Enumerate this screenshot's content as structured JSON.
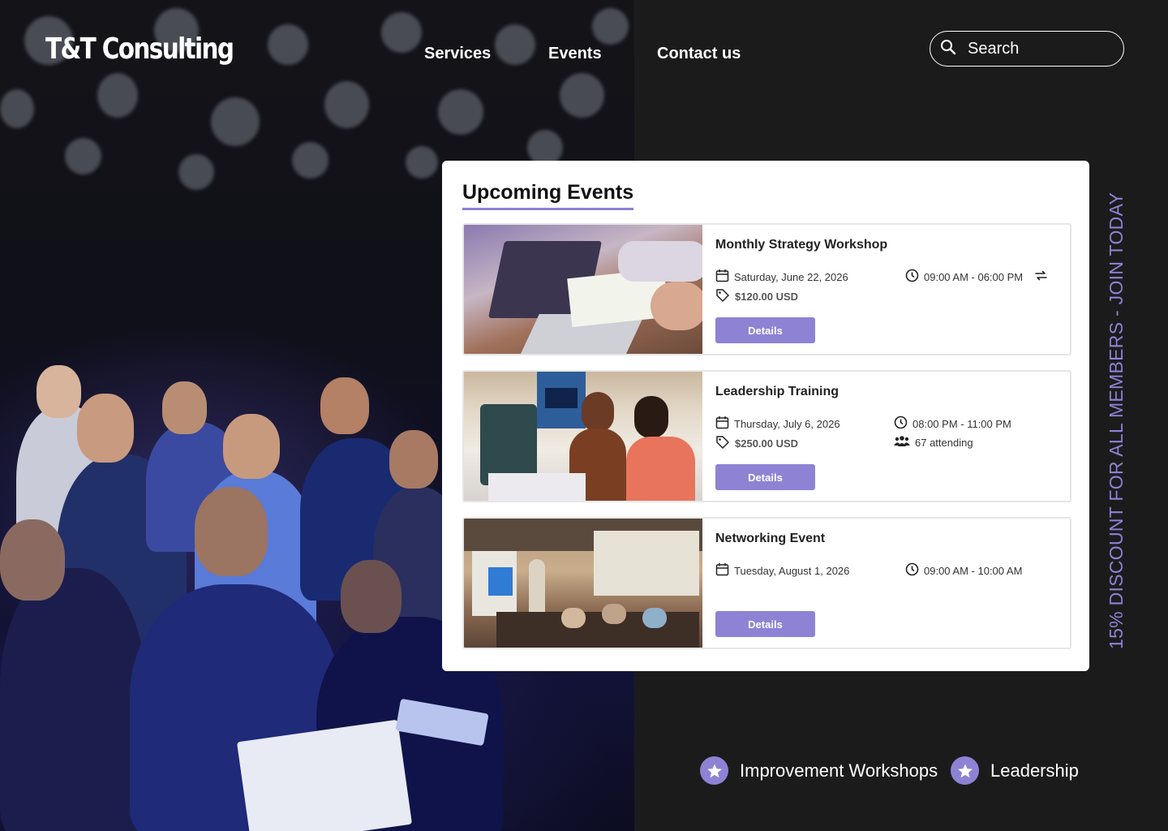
{
  "header": {
    "logo": "T&T Consulting",
    "nav": [
      {
        "label": "Services"
      },
      {
        "label": "Events"
      },
      {
        "label": "Contact us"
      }
    ],
    "search": {
      "placeholder": "Search",
      "icon": "search-icon"
    }
  },
  "events_panel": {
    "title": "Upcoming Events",
    "events": [
      {
        "name": "Monthly Strategy Workshop",
        "date": "Saturday, June 22, 2026",
        "time": "09:00 AM - 06:00 PM",
        "price": "$120.00 USD",
        "recurring": true,
        "button": "Details"
      },
      {
        "name": "Leadership Training",
        "date": "Thursday, July 6, 2026",
        "time": "08:00 PM - 11:00 PM",
        "price": "$250.00 USD",
        "attending": "67 attending",
        "button": "Details"
      },
      {
        "name": "Networking Event",
        "date": "Tuesday, August 1, 2026",
        "time": "09:00 AM - 10:00 AM",
        "button": "Details"
      }
    ]
  },
  "promo": {
    "text": "15% DISCOUNT FOR ALL MEMBERS - JOIN TODAY"
  },
  "tags": [
    {
      "label": "Improvement Workshops",
      "icon": "star-icon"
    },
    {
      "label": "Leadership",
      "icon": "star-icon"
    }
  ],
  "colors": {
    "accent": "#8e82d4",
    "background": "#1c1b1c",
    "card": "#ffffff"
  }
}
